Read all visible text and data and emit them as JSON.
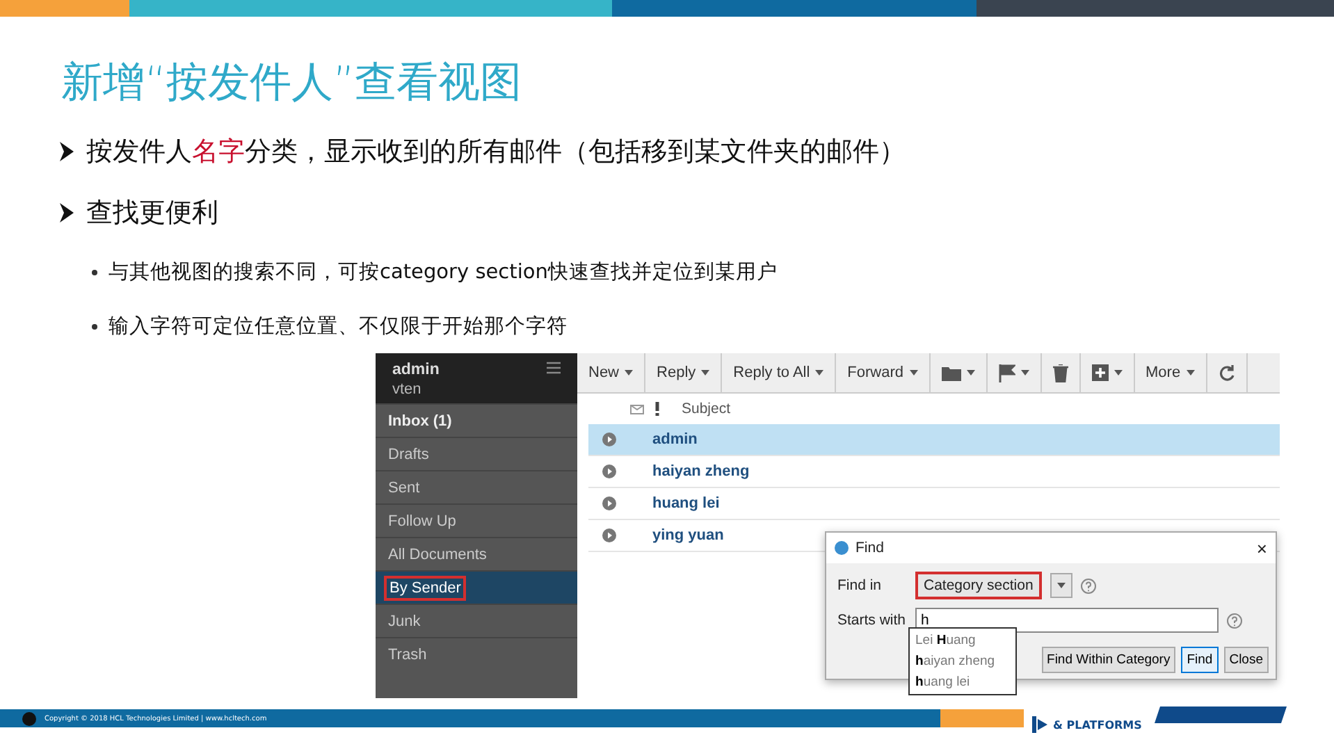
{
  "title": "新增“按发件人”查看视图",
  "bullets": [
    {
      "segments": [
        {
          "text": "按发件人",
          "highlight": false
        },
        {
          "text": "名字",
          "highlight": true
        },
        {
          "text": "分类，显示收到的所有邮件（包括移到某文件夹的邮件）",
          "highlight": false
        }
      ]
    },
    {
      "segments": [
        {
          "text": "查找更便利",
          "highlight": false
        }
      ],
      "children": [
        "与其他视图的搜索不同，可按category section快速查找并定位到某用户",
        "输入字符可定位任意位置、不仅限于开始那个字符"
      ]
    }
  ],
  "app": {
    "sidebar": {
      "user": "admin",
      "subuser": "vten",
      "items": [
        {
          "label": "Inbox (1)",
          "selected": false,
          "bold": true,
          "outlined": false
        },
        {
          "label": "Drafts",
          "selected": false,
          "bold": false,
          "outlined": false
        },
        {
          "label": "Sent",
          "selected": false,
          "bold": false,
          "outlined": false
        },
        {
          "label": "Follow Up",
          "selected": false,
          "bold": false,
          "outlined": false
        },
        {
          "label": "All Documents",
          "selected": false,
          "bold": false,
          "outlined": false
        },
        {
          "label": "By Sender",
          "selected": true,
          "bold": false,
          "outlined": true
        },
        {
          "label": "Junk",
          "selected": false,
          "bold": false,
          "outlined": false
        },
        {
          "label": "Trash",
          "selected": false,
          "bold": false,
          "outlined": false
        }
      ]
    },
    "toolbar": [
      {
        "kind": "text",
        "label": "New"
      },
      {
        "kind": "text",
        "label": "Reply"
      },
      {
        "kind": "text",
        "label": "Reply to All"
      },
      {
        "kind": "text",
        "label": "Forward"
      },
      {
        "kind": "folder"
      },
      {
        "kind": "flag"
      },
      {
        "kind": "trash"
      },
      {
        "kind": "plus"
      },
      {
        "kind": "text",
        "label": "More"
      },
      {
        "kind": "refresh"
      }
    ],
    "column": "Subject",
    "rows": [
      {
        "sender": "admin",
        "selected": true
      },
      {
        "sender": "haiyan zheng",
        "selected": false
      },
      {
        "sender": "huang lei",
        "selected": false
      },
      {
        "sender": "ying yuan",
        "selected": false
      }
    ],
    "find": {
      "title": "Find",
      "close": "×",
      "find_in_label": "Find in",
      "find_in_value": "Category section",
      "find_in_outlined": true,
      "starts_with_label": "Starts with",
      "starts_with_value": "h",
      "suggestions": [
        "Lei **H**uang",
        "**h**aiyan zheng",
        "**h**uang lei"
      ],
      "buttons": [
        {
          "label": "Find Within Category",
          "selected": false
        },
        {
          "label": "Find",
          "selected": true
        },
        {
          "label": "Close",
          "selected": false
        }
      ]
    }
  },
  "footer": {
    "copyright": "Copyright © 2018 HCL Technologies Limited | www.hcltech.com",
    "brand": "& PLATFORMS"
  }
}
